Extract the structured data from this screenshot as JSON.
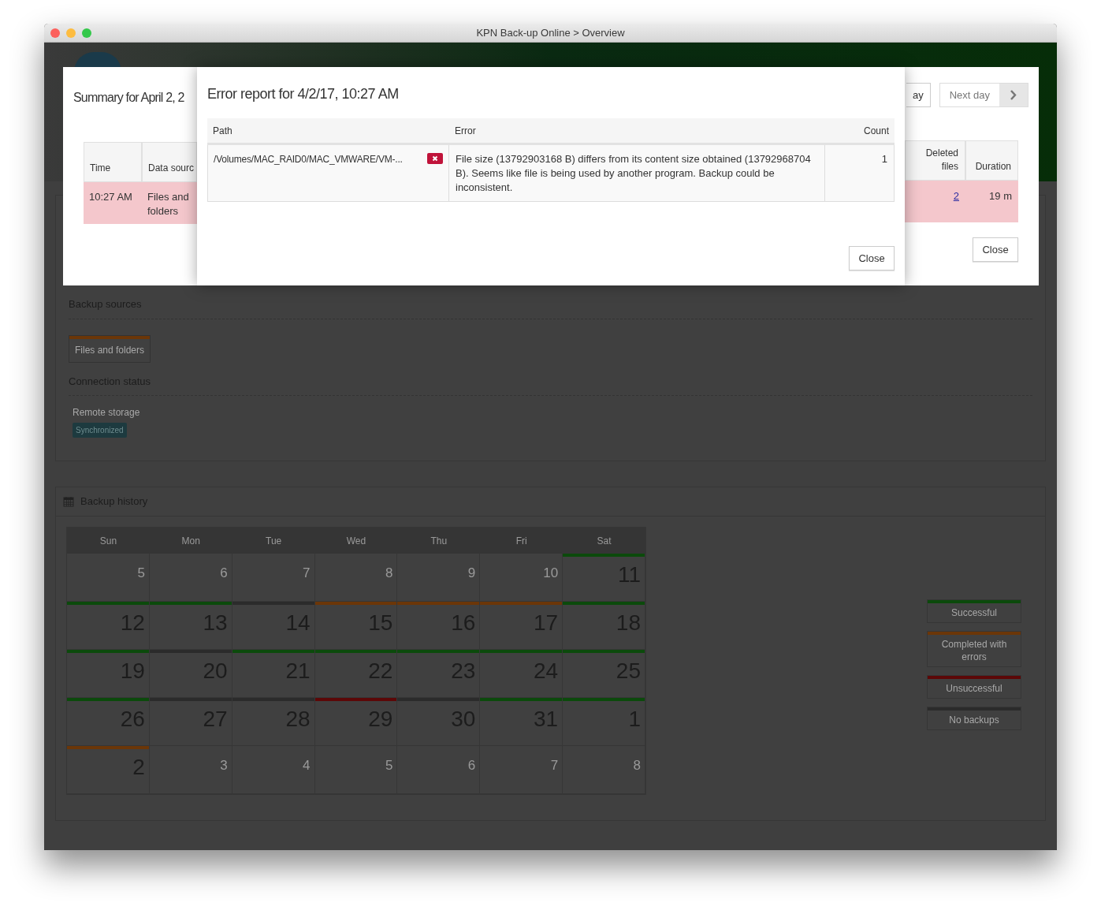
{
  "window": {
    "title": "KPN Back-up Online > Overview"
  },
  "backup_sources": {
    "heading": "Backup sources",
    "items": [
      {
        "label": "Files and folders",
        "color": "#6b3608"
      }
    ]
  },
  "connection_status": {
    "heading": "Connection status",
    "items": [
      {
        "label": "Remote storage",
        "badge": "Synchronized"
      }
    ]
  },
  "backup_history": {
    "title": "Backup history",
    "weekdays": [
      "Sun",
      "Mon",
      "Tue",
      "Wed",
      "Thu",
      "Fri",
      "Sat"
    ],
    "weeks": [
      [
        {
          "day": "5",
          "in_month": false
        },
        {
          "day": "6",
          "in_month": false
        },
        {
          "day": "7",
          "in_month": false
        },
        {
          "day": "8",
          "in_month": false
        },
        {
          "day": "9",
          "in_month": false
        },
        {
          "day": "10",
          "in_month": false
        },
        {
          "day": "11",
          "in_month": true,
          "color": "#0b4a0b"
        }
      ],
      [
        {
          "day": "12",
          "in_month": true,
          "color": "#0b4a0b"
        },
        {
          "day": "13",
          "in_month": true,
          "color": "#0b4a0b"
        },
        {
          "day": "14",
          "in_month": true,
          "color": "#2b2b2b"
        },
        {
          "day": "15",
          "in_month": true,
          "color": "#6b3608"
        },
        {
          "day": "16",
          "in_month": true,
          "color": "#6b3608"
        },
        {
          "day": "17",
          "in_month": true,
          "color": "#6b3608"
        },
        {
          "day": "18",
          "in_month": true,
          "color": "#0b4a0b"
        }
      ],
      [
        {
          "day": "19",
          "in_month": true,
          "color": "#0b4a0b"
        },
        {
          "day": "20",
          "in_month": true,
          "color": "#2b2b2b"
        },
        {
          "day": "21",
          "in_month": true,
          "color": "#0b4a0b"
        },
        {
          "day": "22",
          "in_month": true,
          "color": "#0b4a0b"
        },
        {
          "day": "23",
          "in_month": true,
          "color": "#0b4a0b"
        },
        {
          "day": "24",
          "in_month": true,
          "color": "#0b4a0b"
        },
        {
          "day": "25",
          "in_month": true,
          "color": "#0b4a0b"
        }
      ],
      [
        {
          "day": "26",
          "in_month": true,
          "color": "#0b4a0b"
        },
        {
          "day": "27",
          "in_month": true,
          "color": "#2b2b2b"
        },
        {
          "day": "28",
          "in_month": true,
          "color": "#2b2b2b"
        },
        {
          "day": "29",
          "in_month": true,
          "color": "#5c0707"
        },
        {
          "day": "30",
          "in_month": true,
          "color": "#2b2b2b"
        },
        {
          "day": "31",
          "in_month": true,
          "color": "#0b4a0b"
        },
        {
          "day": "1",
          "in_month": true,
          "color": "#0b4a0b"
        }
      ],
      [
        {
          "day": "2",
          "in_month": true,
          "color": "#6b3608"
        },
        {
          "day": "3",
          "in_month": false
        },
        {
          "day": "4",
          "in_month": false
        },
        {
          "day": "5",
          "in_month": false
        },
        {
          "day": "6",
          "in_month": false
        },
        {
          "day": "7",
          "in_month": false
        },
        {
          "day": "8",
          "in_month": false
        }
      ]
    ]
  },
  "legend": [
    {
      "label": "Successful",
      "color": "#0b4a0b"
    },
    {
      "label": "Completed with errors",
      "color": "#6b3608"
    },
    {
      "label": "Unsuccessful",
      "color": "#5c0707"
    },
    {
      "label": "No backups",
      "color": "#2b2b2b"
    }
  ],
  "summary_dialog": {
    "title": "Summary for April 2, 2",
    "prev_button": "ay",
    "next_button": "Next day",
    "columns_left": [
      "Time",
      "Data sourc"
    ],
    "columns_right": [
      "Deleted files",
      "Duration"
    ],
    "row_left": [
      "10:27 AM",
      "Files and folders"
    ],
    "deleted_files": "2",
    "duration": "19 m",
    "close_button": "Close"
  },
  "error_dialog": {
    "title": "Error report for 4/2/17, 10:27 AM",
    "columns": [
      "Path",
      "Error",
      "Count"
    ],
    "rows": [
      {
        "path": "/Volumes/MAC_RAID0/MAC_VMWARE/VM-...",
        "error": "File size (13792903168 B) differs from its content size obtained (13792968704 B). Seems like file is being used by another program. Backup could be inconsistent.",
        "count": "1"
      }
    ],
    "close_button": "Close"
  }
}
